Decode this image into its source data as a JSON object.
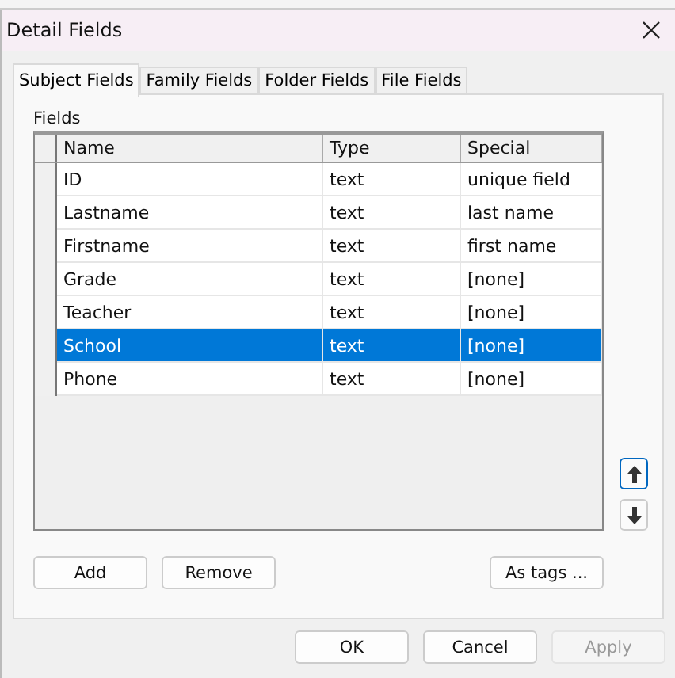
{
  "window": {
    "title": "Detail Fields"
  },
  "tabs": [
    {
      "label": "Subject Fields",
      "selected": true
    },
    {
      "label": "Family Fields",
      "selected": false
    },
    {
      "label": "Folder Fields",
      "selected": false
    },
    {
      "label": "File Fields",
      "selected": false
    }
  ],
  "fields": {
    "label": "Fields",
    "columns": [
      "Name",
      "Type",
      "Special"
    ],
    "rows": [
      {
        "cells": [
          "ID",
          "text",
          "unique field"
        ],
        "selected": false
      },
      {
        "cells": [
          "Lastname",
          "text",
          "last name"
        ],
        "selected": false
      },
      {
        "cells": [
          "Firstname",
          "text",
          "first name"
        ],
        "selected": false
      },
      {
        "cells": [
          "Grade",
          "text",
          "[none]"
        ],
        "selected": false
      },
      {
        "cells": [
          "Teacher",
          "text",
          "[none]"
        ],
        "selected": false
      },
      {
        "cells": [
          "School",
          "text",
          "[none]"
        ],
        "selected": true
      },
      {
        "cells": [
          "Phone",
          "text",
          "[none]"
        ],
        "selected": false
      }
    ]
  },
  "list_buttons": [
    "Add",
    "Remove"
  ],
  "tags_button": "As tags ...",
  "dialog_buttons": [
    {
      "label": "OK",
      "disabled": false
    },
    {
      "label": "Cancel",
      "disabled": false
    },
    {
      "label": "Apply",
      "disabled": true
    }
  ]
}
